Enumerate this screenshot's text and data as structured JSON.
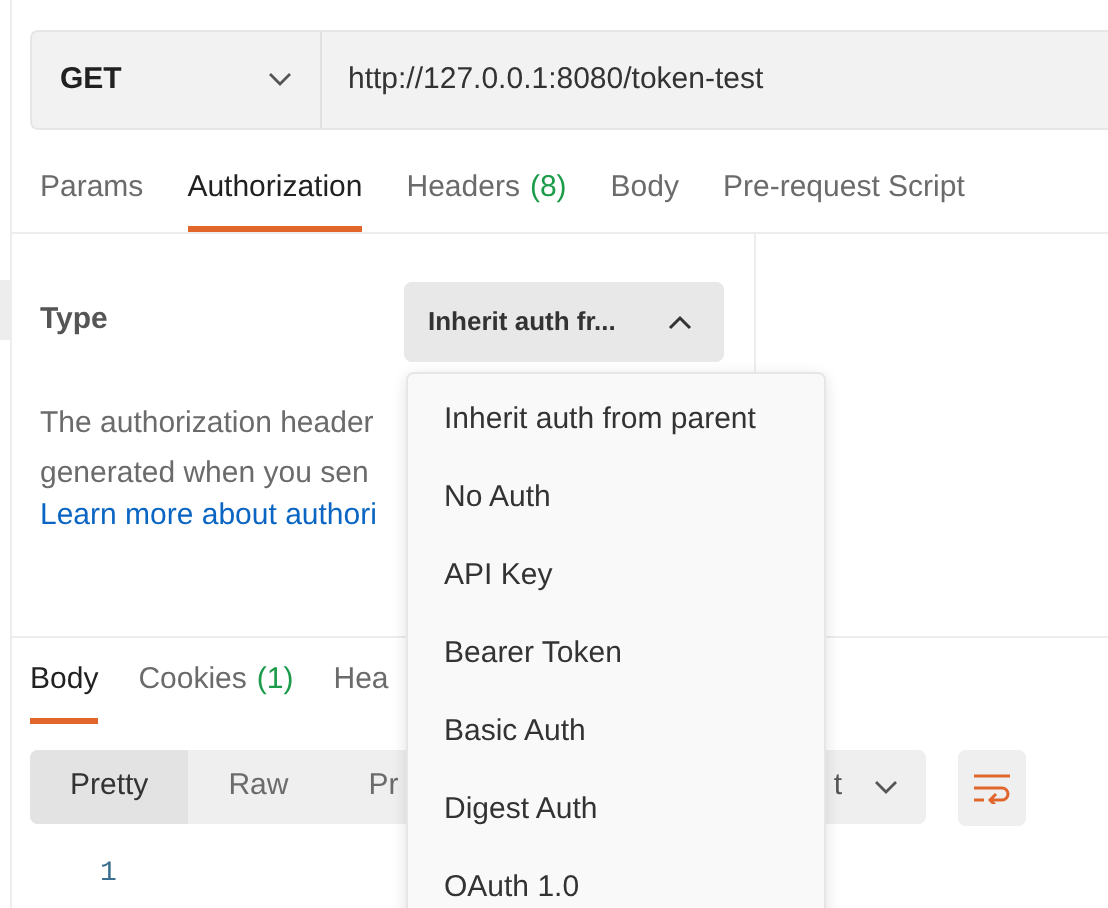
{
  "request": {
    "method": "GET",
    "url": "http://127.0.0.1:8080/token-test"
  },
  "request_tabs": [
    {
      "label": "Params",
      "selected": false
    },
    {
      "label": "Authorization",
      "selected": true
    },
    {
      "label": "Headers",
      "count": "(8)",
      "selected": false
    },
    {
      "label": "Body",
      "selected": false
    },
    {
      "label": "Pre-request Script",
      "selected": false
    }
  ],
  "auth": {
    "type_label": "Type",
    "type_value": "Inherit auth fr...",
    "expanded": true,
    "description": [
      "The authorization header",
      "generated when you sen"
    ],
    "link": "Learn more about authori"
  },
  "auth_menu": [
    "Inherit auth from parent",
    "No Auth",
    "API Key",
    "Bearer Token",
    "Basic Auth",
    "Digest Auth",
    "OAuth 1.0"
  ],
  "response_tabs": [
    {
      "label": "Body",
      "selected": true
    },
    {
      "label": "Cookies",
      "count": "(1)",
      "selected": false
    },
    {
      "label": "Hea",
      "selected": false
    }
  ],
  "view_modes": [
    {
      "label": "Pretty",
      "selected": true
    },
    {
      "label": "Raw",
      "selected": false
    },
    {
      "label": "Pr",
      "selected": false
    }
  ],
  "format_dropdown": "t",
  "line_numbers": [
    "1"
  ]
}
